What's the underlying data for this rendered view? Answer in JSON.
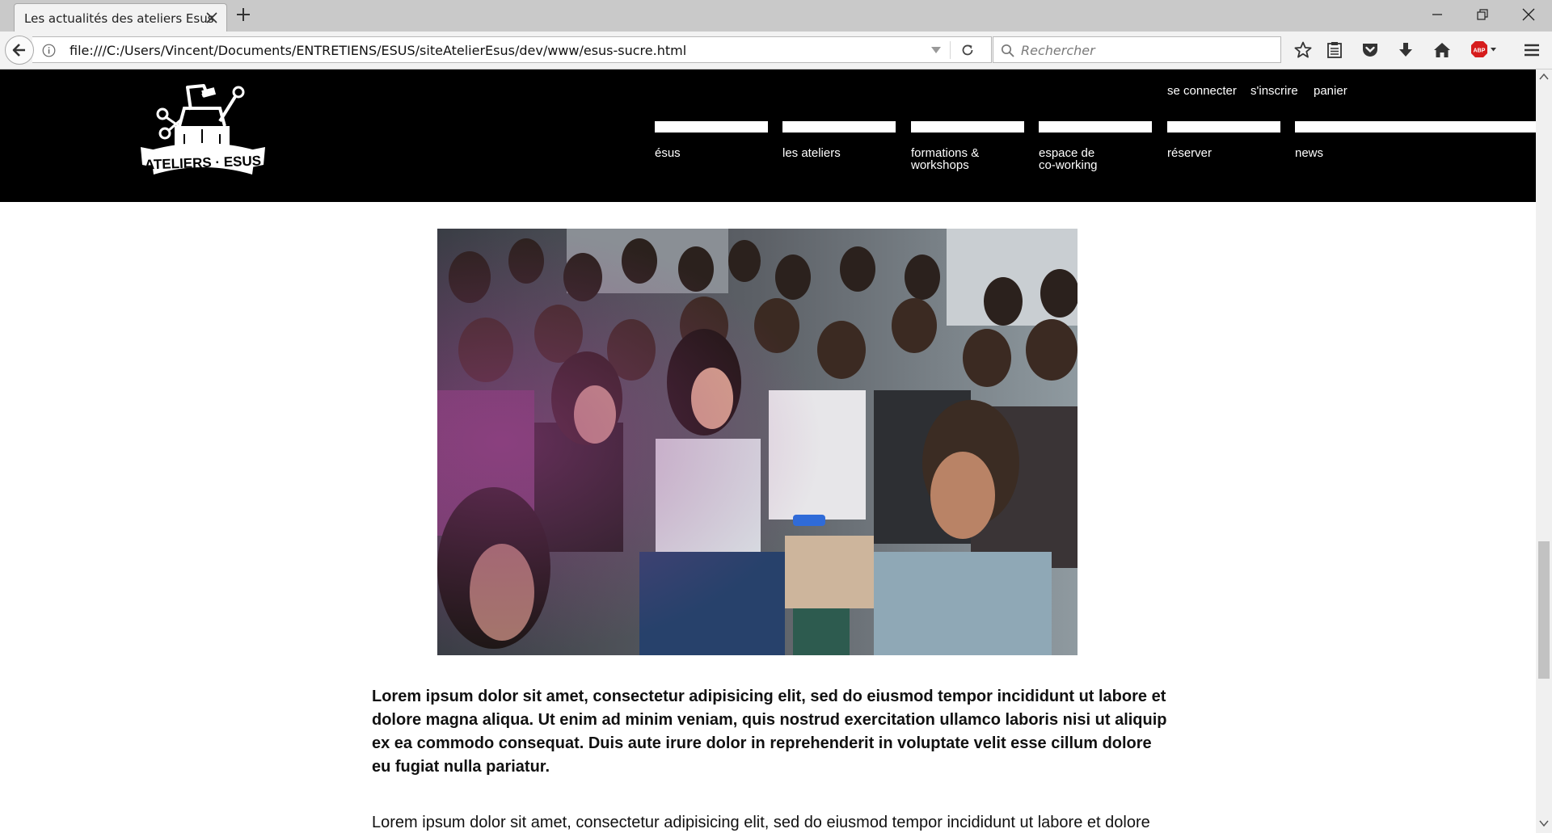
{
  "browser": {
    "tab_title": "Les actualités des ateliers Esus",
    "url": "file:///C:/Users/Vincent/Documents/ENTRETIENS/ESUS/siteAtelierEsus/dev/www/esus-sucre.html",
    "search_placeholder": "Rechercher",
    "toolbar_icons": [
      "bookmark-star-icon",
      "reading-list-icon",
      "pocket-icon",
      "download-icon",
      "home-icon",
      "adblock-icon",
      "menu-icon"
    ]
  },
  "site": {
    "logo_text": "ATELIERS · ESUS",
    "util_links": [
      "se connecter",
      "s'inscrire",
      "panier"
    ],
    "nav": [
      {
        "label": "ésus"
      },
      {
        "label": "les ateliers"
      },
      {
        "label": "formations &\nworkshops"
      },
      {
        "label": "espace de\nco-working"
      },
      {
        "label": "réserver"
      },
      {
        "label": "news"
      }
    ],
    "colors": {
      "header_bg": "#000000",
      "nav_text": "#ffffff"
    }
  },
  "article": {
    "lead": "Lorem ipsum dolor sit amet, consectetur adipisicing elit, sed do eiusmod tempor incididunt ut labore et dolore magna aliqua. Ut enim ad minim veniam, quis nostrud exercitation ullamco laboris nisi ut aliquip ex ea commodo consequat. Duis aute irure dolor in reprehenderit in voluptate velit esse cillum dolore eu fugiat nulla pariatur.",
    "body": "Lorem ipsum dolor sit amet, consectetur adipisicing elit, sed do eiusmod tempor incididunt ut labore et dolore"
  }
}
